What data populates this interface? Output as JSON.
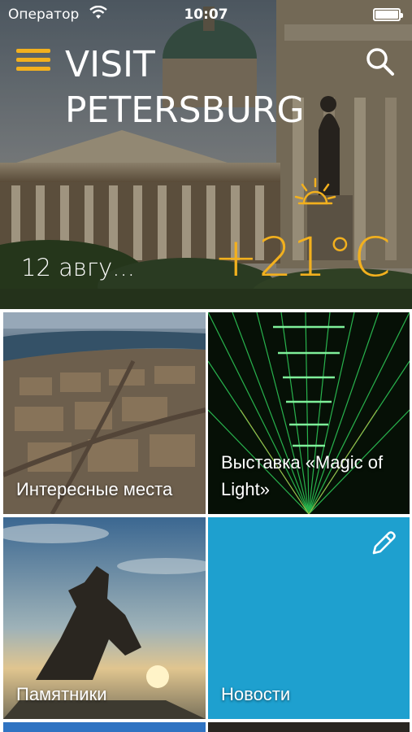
{
  "status_bar": {
    "carrier": "Оператор",
    "time": "10:07"
  },
  "header": {
    "title_line1": "VISIT",
    "title_line2": "PETERSBURG",
    "menu_icon": "hamburger-menu-icon",
    "search_icon": "search-icon"
  },
  "weather": {
    "date": "12 авгу...",
    "temperature": "+21°C",
    "icon": "sun-icon"
  },
  "tiles": [
    {
      "label": "Интересные места",
      "image": "aerial-city-view"
    },
    {
      "label": "Выставка «Magic of Light»",
      "image": "green-laser-lights"
    },
    {
      "label": "Памятники",
      "image": "bronze-horseman-statue"
    },
    {
      "label": "Новости",
      "icon": "pencil-icon"
    }
  ],
  "colors": {
    "accent": "#f2b01e",
    "news_tile": "#1ea0cf",
    "text": "#ffffff"
  }
}
